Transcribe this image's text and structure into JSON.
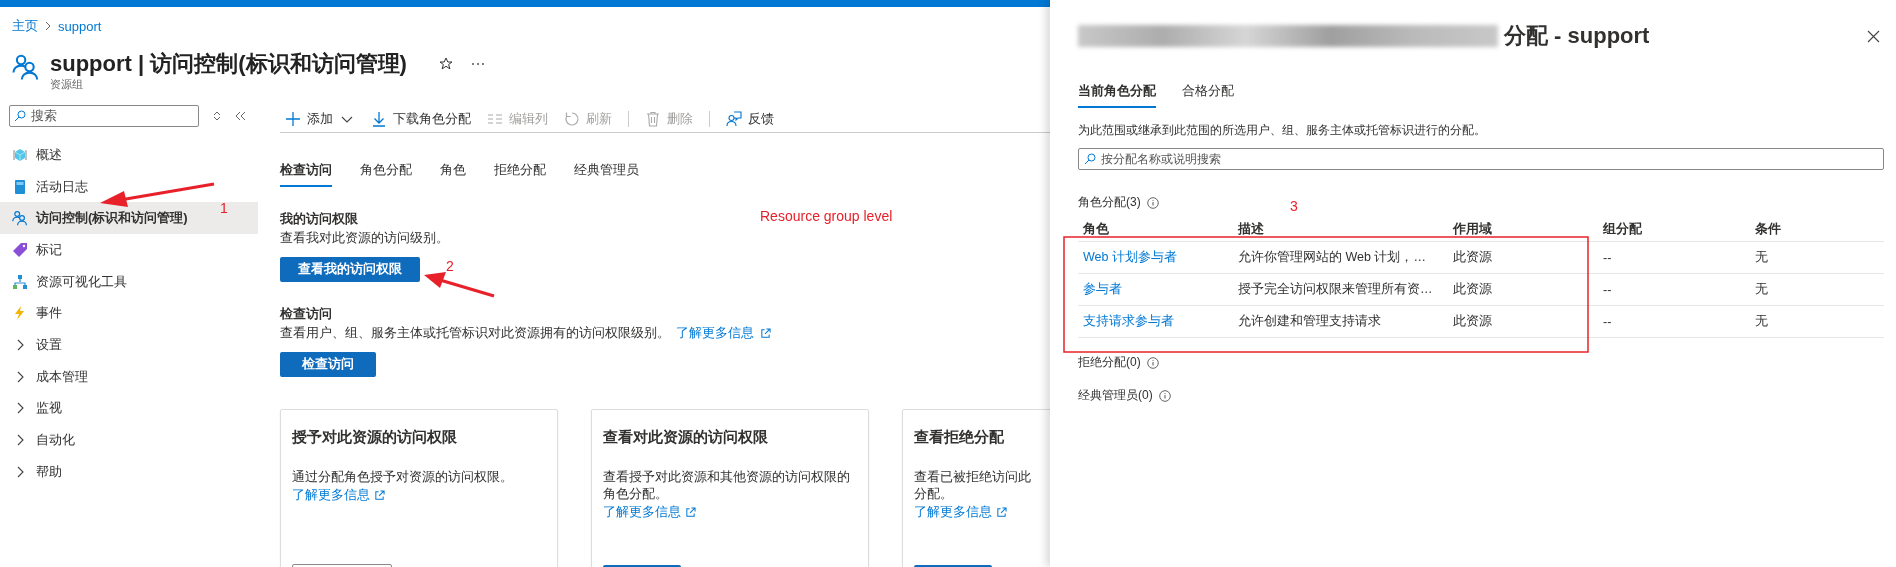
{
  "breadcrumb": [
    "主页",
    "support"
  ],
  "header": {
    "title": "support | 访问控制(标识和访问管理)",
    "subtitle": "资源组"
  },
  "sidebar": {
    "search": {
      "placeholder": "搜索"
    },
    "items": [
      {
        "label": "概述",
        "kind": "page",
        "selected": false
      },
      {
        "label": "活动日志",
        "kind": "page",
        "selected": false
      },
      {
        "label": "访问控制(标识和访问管理)",
        "kind": "page",
        "selected": true
      },
      {
        "label": "标记",
        "kind": "page",
        "selected": false
      },
      {
        "label": "资源可视化工具",
        "kind": "page",
        "selected": false
      },
      {
        "label": "事件",
        "kind": "page",
        "selected": false
      },
      {
        "label": "设置",
        "kind": "group",
        "expanded": false,
        "selected": false
      },
      {
        "label": "成本管理",
        "kind": "group",
        "expanded": false,
        "selected": false
      },
      {
        "label": "监视",
        "kind": "group",
        "expanded": false,
        "selected": false
      },
      {
        "label": "自动化",
        "kind": "group",
        "expanded": false,
        "selected": false
      },
      {
        "label": "帮助",
        "kind": "group",
        "expanded": false,
        "selected": false
      }
    ]
  },
  "toolbar": [
    {
      "label": "添加",
      "disabled": false
    },
    {
      "label": "下载角色分配",
      "disabled": false
    },
    {
      "label": "编辑列",
      "disabled": true
    },
    {
      "label": "刷新",
      "disabled": true
    },
    {
      "label": "删除",
      "disabled": true
    },
    {
      "label": "反馈",
      "disabled": false
    }
  ],
  "tabs": [
    {
      "label": "检查访问",
      "selected": true
    },
    {
      "label": "角色分配",
      "selected": false
    },
    {
      "label": "角色",
      "selected": false
    },
    {
      "label": "拒绝分配",
      "selected": false
    },
    {
      "label": "经典管理员",
      "selected": false
    }
  ],
  "my_access": {
    "heading": "我的访问权限",
    "text": "查看我对此资源的访问级别。",
    "button": "查看我的访问权限"
  },
  "check_access": {
    "heading": "检查访问",
    "text": "查看用户、组、服务主体或托管标识对此资源拥有的访问权限级别。",
    "link": "了解更多信息",
    "button": "检查访问"
  },
  "cards": [
    {
      "title": "授予对此资源的访问权限",
      "lines": [
        "通过分配角色授予对资源的访问权限。"
      ],
      "link": "了解更多信息",
      "kind": "outline"
    },
    {
      "title": "查看对此资源的访问权限",
      "lines": [
        "查看授予对此资源和其他资源的访问权限的",
        "角色分配。"
      ],
      "link": "了解更多信息",
      "kind": "primary"
    },
    {
      "title": "查看拒绝分配",
      "lines": [
        "查看已被拒绝访问此",
        "分配。"
      ],
      "link": "了解更多信息",
      "kind": "primary"
    }
  ],
  "panel": {
    "title": "分配 - support",
    "tabs": [
      {
        "label": "当前角色分配",
        "selected": true
      },
      {
        "label": "合格分配",
        "selected": false
      }
    ],
    "description": "为此范围或继承到此范围的所选用户、组、服务主体或托管标识进行的分配。",
    "search": {
      "placeholder": "按分配名称或说明搜索"
    },
    "role_assignments": {
      "heading": "角色分配(3)",
      "columns": [
        "角色",
        "描述",
        "作用域",
        "组分配",
        "条件"
      ],
      "rows": [
        [
          "Web 计划参与者",
          "允许你管理网站的 Web 计划，…",
          "此资源",
          "--",
          "无"
        ],
        [
          "参与者",
          "授予完全访问权限来管理所有资…",
          "此资源",
          "--",
          "无"
        ],
        [
          "支持请求参与者",
          "允许创建和管理支持请求",
          "此资源",
          "--",
          "无"
        ]
      ]
    },
    "sections": [
      "拒绝分配(0)",
      "经典管理员(0)"
    ]
  },
  "annotations": [
    "1",
    "2",
    "Resource group level",
    "3"
  ]
}
